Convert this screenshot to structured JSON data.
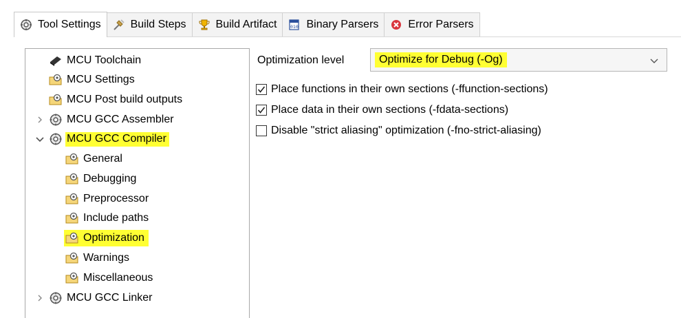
{
  "tabs": [
    {
      "label": "Tool Settings",
      "icon": "gear-globe-icon",
      "active": true
    },
    {
      "label": "Build Steps",
      "icon": "build-steps-icon",
      "active": false
    },
    {
      "label": "Build Artifact",
      "icon": "trophy-icon",
      "active": false
    },
    {
      "label": "Binary Parsers",
      "icon": "binary-file-icon",
      "active": false
    },
    {
      "label": "Error Parsers",
      "icon": "error-icon",
      "active": false
    }
  ],
  "tree": {
    "items": [
      {
        "label": "MCU Toolchain",
        "icon": "toolchain-icon",
        "expander": ""
      },
      {
        "label": "MCU Settings",
        "icon": "folder-gear-icon",
        "expander": ""
      },
      {
        "label": "MCU Post build outputs",
        "icon": "folder-gear-icon",
        "expander": ""
      },
      {
        "label": "MCU GCC Assembler",
        "icon": "gear-globe-icon",
        "expander": "collapsed"
      },
      {
        "label": "MCU GCC Compiler",
        "icon": "gear-globe-icon",
        "expander": "expanded",
        "highlighted": true
      },
      {
        "label": "General",
        "icon": "folder-gear-icon"
      },
      {
        "label": "Debugging",
        "icon": "folder-gear-icon"
      },
      {
        "label": "Preprocessor",
        "icon": "folder-gear-icon"
      },
      {
        "label": "Include paths",
        "icon": "folder-gear-icon"
      },
      {
        "label": "Optimization",
        "icon": "folder-gear-icon",
        "highlighted": true,
        "selected": true
      },
      {
        "label": "Warnings",
        "icon": "folder-gear-icon"
      },
      {
        "label": "Miscellaneous",
        "icon": "folder-gear-icon"
      },
      {
        "label": "MCU GCC Linker",
        "icon": "gear-globe-icon",
        "expander": "collapsed"
      }
    ]
  },
  "options": {
    "level_label": "Optimization level",
    "level_value": "Optimize for Debug (-Og)",
    "checkboxes": [
      {
        "label": "Place functions in their own sections (-ffunction-sections)",
        "checked": true
      },
      {
        "label": "Place data in their own sections (-fdata-sections)",
        "checked": true
      },
      {
        "label": "Disable \"strict aliasing\" optimization (-fno-strict-aliasing)",
        "checked": false
      }
    ]
  },
  "colors": {
    "highlight": "#ffff33",
    "tree_border": "#a8a8a8",
    "select_bg": "#f6f6f6"
  }
}
